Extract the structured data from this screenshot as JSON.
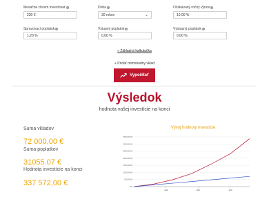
{
  "form": {
    "monthly_investment": {
      "label": "Mesačne chcem investovať",
      "value": "230 €"
    },
    "duration": {
      "label": "Doba",
      "value": "30 rokov"
    },
    "expected_return": {
      "label": "Očakávaný ročný výnos",
      "value": "10,00 %"
    },
    "management_fee": {
      "label": "Spravovací poplatok",
      "value": "1,20 %"
    },
    "entry_fee": {
      "label": "Vstupný poplatok",
      "value": "0,00 %"
    },
    "exit_fee": {
      "label": "Výstupný poplatok",
      "value": "0,00 %"
    }
  },
  "links": {
    "basic_calculator": "« Základná kalkulačka",
    "add_extra_deposit": "+ Pridať mimoriadny vklad"
  },
  "button": {
    "calculate_label": "Vypočítať"
  },
  "result": {
    "title": "Výsledok",
    "subtitle": "hodnota vašej investície na konci",
    "deposits_label": "Suma vkladov",
    "deposits_value": "72 000,00 €",
    "fees_label": "Suma poplatkov",
    "fees_value": "31055.07 €",
    "end_value_label": "Hodnota investície na konci",
    "end_value_value": "337 572,00 €"
  },
  "colors": {
    "brand_red": "#c0172e",
    "accent_orange": "#f0a500",
    "investment_line": "#b5122b",
    "deposit_line": "#3355cc"
  },
  "chart_data": {
    "type": "line",
    "title": "Vývoj hodnoty investície",
    "xlabel": "",
    "ylabel": "",
    "x_ticks": [
      "100",
      "200",
      "300"
    ],
    "y_ticks": [
      "0 €",
      "50 000 €",
      "100 000 €",
      "150 000 €",
      "200 000 €",
      "250 000 €",
      "300 000 €",
      "350 000 €"
    ],
    "xlim": [
      0,
      360
    ],
    "ylim": [
      0,
      350000
    ],
    "grid": true,
    "series": [
      {
        "color": "#b5122b",
        "x": [
          0,
          60,
          120,
          180,
          240,
          300,
          360
        ],
        "values": [
          0,
          17000,
          48000,
          92000,
          158000,
          232000,
          337572
        ]
      },
      {
        "color": "#3355cc",
        "x": [
          0,
          60,
          120,
          180,
          240,
          300,
          360
        ],
        "values": [
          0,
          12000,
          24000,
          36000,
          48000,
          60000,
          72000
        ]
      }
    ]
  }
}
